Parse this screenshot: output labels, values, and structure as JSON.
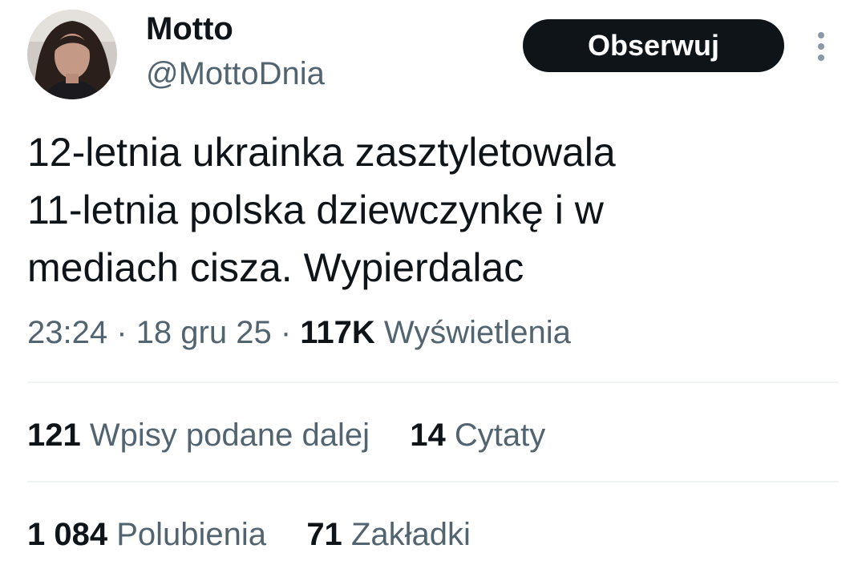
{
  "author": {
    "display_name": "Motto",
    "handle": "@MottoDnia",
    "avatar_icon": "profile-photo"
  },
  "header": {
    "follow_label": "Obserwuj",
    "more_icon": "vertical-ellipsis-icon"
  },
  "tweet": {
    "text": "12-letnia ukrainka zasztyletowala\n11-letnia polska dziewczynkę i w\nmediach cisza. Wypierdalac"
  },
  "meta": {
    "time": "23:24",
    "separator": "·",
    "date": "18 gru 25",
    "views_count": "117K",
    "views_label": "Wyświetlenia"
  },
  "stats": {
    "reposts": {
      "count": "121",
      "label": "Wpisy podane dalej"
    },
    "quotes": {
      "count": "14",
      "label": "Cytaty"
    },
    "likes": {
      "count": "1 084",
      "label": "Polubienia"
    },
    "bookmarks": {
      "count": "71",
      "label": "Zakładki"
    }
  },
  "colors": {
    "text_primary": "#0f1419",
    "text_secondary": "#536471",
    "divider": "#eff3f4",
    "button_bg": "#0f1419",
    "button_text": "#ffffff"
  }
}
